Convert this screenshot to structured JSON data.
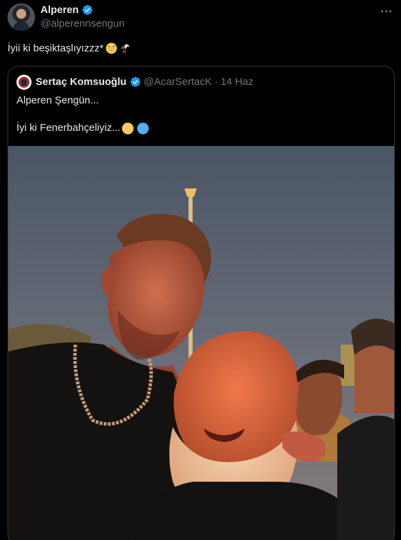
{
  "tweet": {
    "author": {
      "display_name": "Alperen",
      "handle": "@alperennsengun",
      "verified": true
    },
    "text": "İyii ki beşiktaşlıyızzz*",
    "emojis": [
      "grinning-sweat-emoji",
      "eagle-emoji"
    ]
  },
  "quote": {
    "author": {
      "display_name": "Sertaç Komsuoğlu",
      "handle": "@AcarSertacK",
      "separator": "·",
      "date": "14 Haz",
      "verified": true
    },
    "line1": "Alperen Şengün...",
    "line2": "İyi ki Fenerbahçeliyiz...",
    "dots": [
      {
        "name": "yellow-circle-emoji",
        "color": "#fdcb58"
      },
      {
        "name": "blue-circle-emoji",
        "color": "#55acee"
      }
    ]
  },
  "colors": {
    "background": "#000000",
    "text": "#e7e9ea",
    "secondary": "#71767b",
    "verified": "#1d9bf0",
    "border": "#2f3336"
  }
}
